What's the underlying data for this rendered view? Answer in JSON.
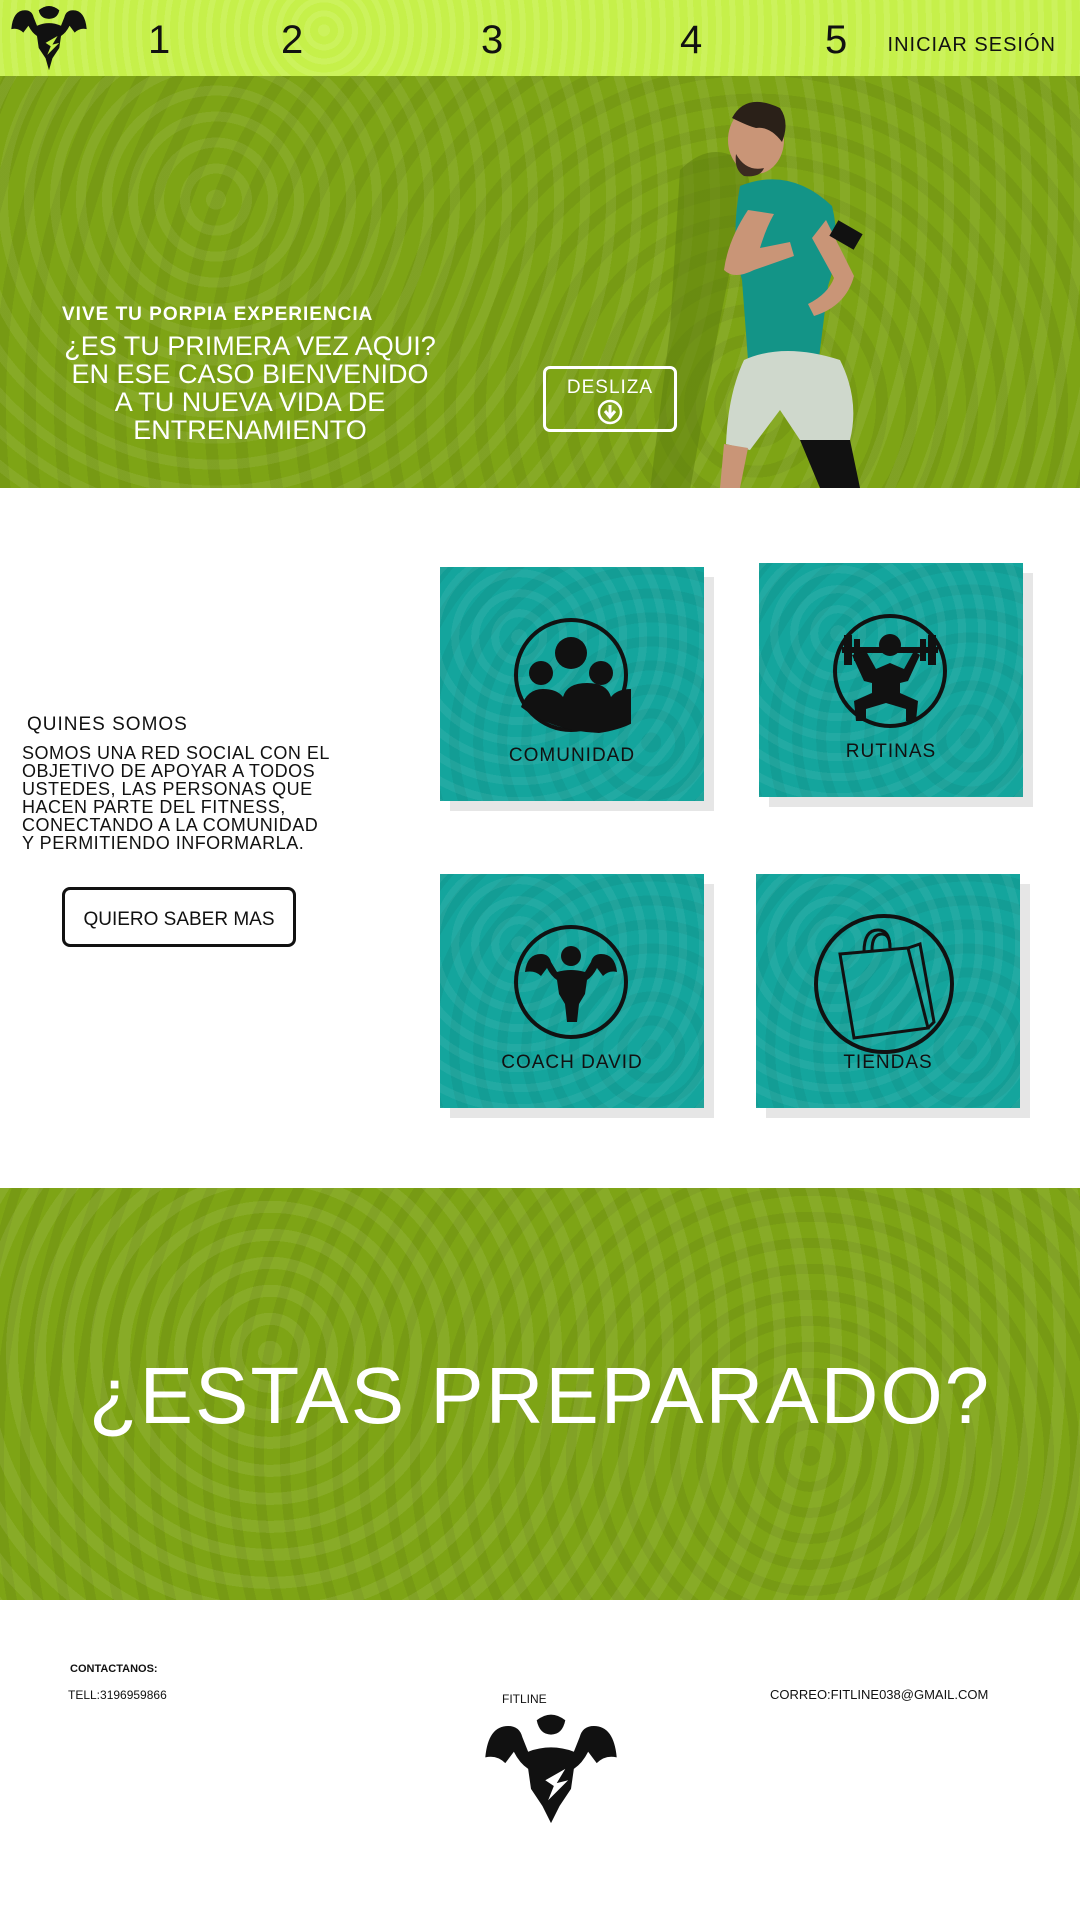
{
  "nav": {
    "items": [
      "1",
      "2",
      "3",
      "4",
      "5"
    ],
    "login_label": "INICIAR SESIÓN",
    "logo_icon": "bodybuilder-logo-icon"
  },
  "hero": {
    "tagline": "VIVE TU PORPIA EXPERIENCIA",
    "title_lines": [
      "¿ES TU PRIMERA VEZ AQUI?",
      "EN ESE CASO BIENVENIDO",
      "A TU NUEVA VIDA DE",
      "ENTRENAMIENTO"
    ],
    "scroll_label": "DESLIZA",
    "scroll_icon": "arrow-down-circle-icon"
  },
  "about": {
    "title": "QUINES SOMOS",
    "text_lines": [
      "SOMOS UNA RED SOCIAL CON EL",
      "OBJETIVO DE APOYAR A TODOS",
      "USTEDES, LAS PERSONAS QUE",
      "HACEN PARTE DEL FITNESS,",
      "CONECTANDO A LA COMUNIDAD",
      "Y PERMITIENDO INFORMARLA."
    ],
    "button_label": "QUIERO SABER MAS"
  },
  "cards": [
    {
      "label": "COMUNIDAD",
      "icon": "community-icon"
    },
    {
      "label": "RUTINAS",
      "icon": "weightlifting-icon"
    },
    {
      "label": "COACH DAVID",
      "icon": "bodybuilder-icon"
    },
    {
      "label": "TIENDAS",
      "icon": "shopping-bag-icon"
    }
  ],
  "banner": {
    "text": "¿ESTAS PREPARADO?"
  },
  "footer": {
    "contact_title": "CONTACTANOS:",
    "phone": "TELL:3196959866",
    "brand": "FITLINE",
    "email": "CORREO:FITLINE038@GMAIL.COM",
    "logo_icon": "bodybuilder-logo-icon"
  },
  "colors": {
    "nav_bg": "#c6f04a",
    "hero_bg": "#7ea415",
    "card_bg": "#14a59d"
  }
}
